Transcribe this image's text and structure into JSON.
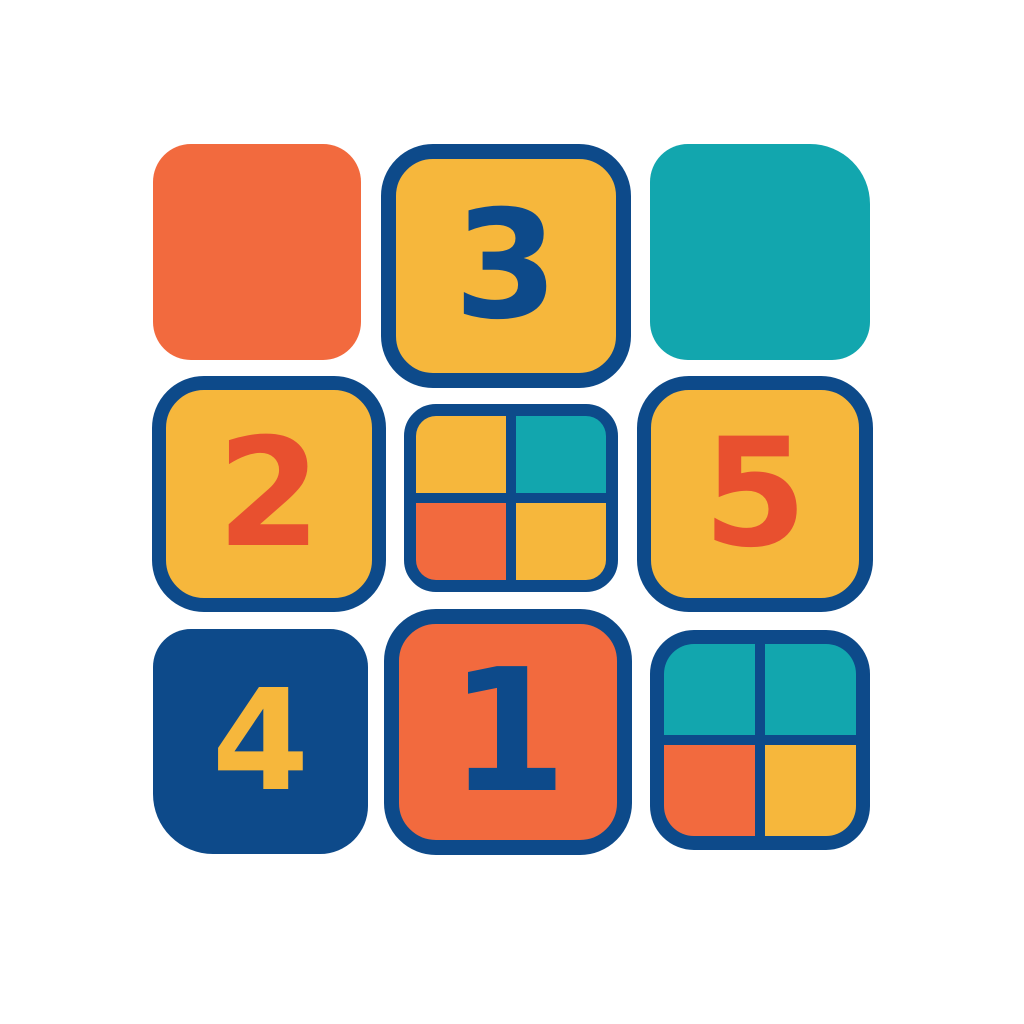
{
  "colors": {
    "orange": "#F26A3E",
    "yellow": "#F6B73C",
    "teal": "#12A6AE",
    "navy": "#0D4A8A",
    "red_digit": "#E8502F"
  },
  "tiles": {
    "top_left": {
      "number": ""
    },
    "top_center": {
      "number": "3"
    },
    "top_right": {
      "number": ""
    },
    "middle_left": {
      "number": "2"
    },
    "middle_right": {
      "number": "5"
    },
    "bottom_left": {
      "number": "4"
    },
    "bottom_center": {
      "number": "1"
    }
  },
  "quad_tiles": {
    "center": {
      "cells": [
        "yellow",
        "teal",
        "orange",
        "yellow"
      ]
    },
    "bottom_right": {
      "cells": [
        "teal",
        "teal",
        "orange",
        "yellow"
      ]
    }
  }
}
